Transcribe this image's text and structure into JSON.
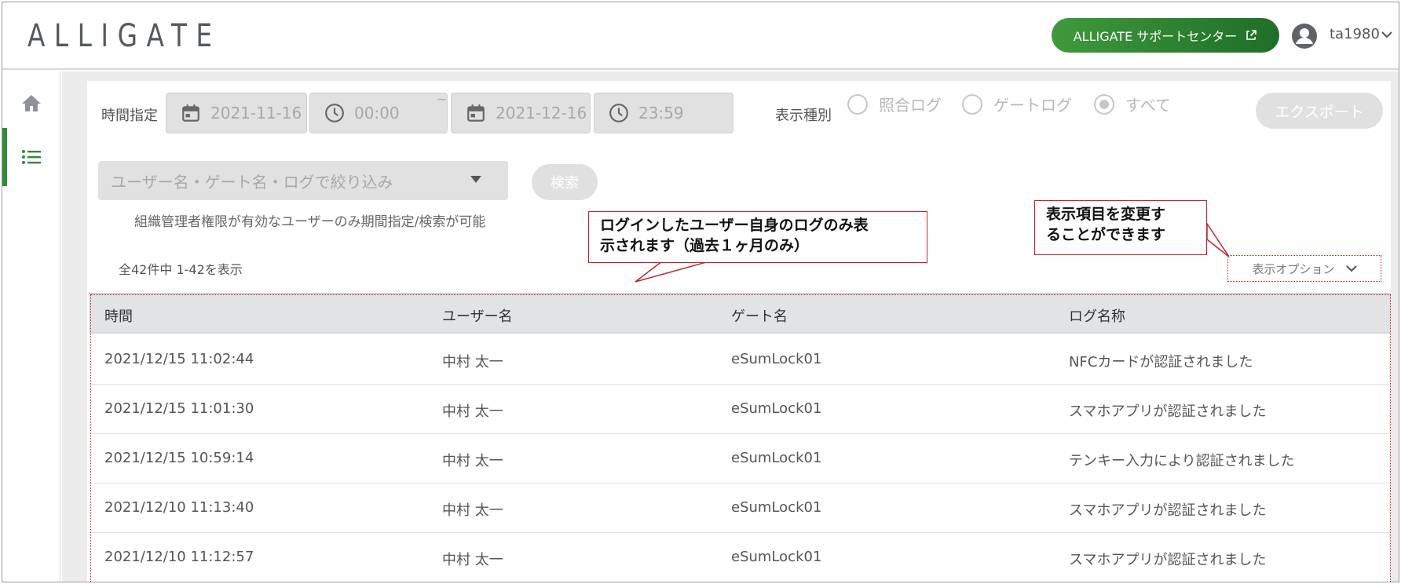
{
  "header": {
    "logo": "ALLIGATE",
    "support_button": "ALLIGATE サポートセンター",
    "username": "ta1980"
  },
  "sidebar": {
    "items": [
      {
        "icon": "home-icon"
      },
      {
        "icon": "list-icon",
        "active": true
      }
    ]
  },
  "filters": {
    "time_label": "時間指定",
    "start_date": "2021-11-16",
    "start_time": "00:00",
    "separator": "~",
    "end_date": "2021-12-16",
    "end_time": "23:59",
    "display_type_label": "表示種別",
    "radio_options": [
      {
        "label": "照合ログ",
        "selected": false
      },
      {
        "label": "ゲートログ",
        "selected": false
      },
      {
        "label": "すべて",
        "selected": true
      }
    ],
    "export_button": "エクスポート",
    "search_placeholder": "ユーザー名・ゲート名・ログで絞り込み",
    "search_button": "検索",
    "search_note": "組織管理者権限が有効なユーザーのみ期間指定/検索が可能",
    "result_count": "全42件中 1-42を表示",
    "display_option": "表示オプション"
  },
  "callouts": {
    "log_note_line1": "ログインしたユーザー自身のログのみ表",
    "log_note_line2": "示されます（過去１ヶ月のみ）",
    "option_note_line1": "表示項目を変更す",
    "option_note_line2": "ることができます"
  },
  "table": {
    "headers": [
      "時間",
      "ユーザー名",
      "ゲート名",
      "ログ名称"
    ],
    "rows": [
      [
        "2021/12/15 11:02:44",
        "中村 太一",
        "eSumLock01",
        "NFCカードが認証されました"
      ],
      [
        "2021/12/15 11:01:30",
        "中村 太一",
        "eSumLock01",
        "スマホアプリが認証されました"
      ],
      [
        "2021/12/15 10:59:14",
        "中村 太一",
        "eSumLock01",
        "テンキー入力により認証されました"
      ],
      [
        "2021/12/10 11:13:40",
        "中村 太一",
        "eSumLock01",
        "スマホアプリが認証されました"
      ],
      [
        "2021/12/10 11:12:57",
        "中村 太一",
        "eSumLock01",
        "スマホアプリが認証されました"
      ]
    ]
  },
  "colors": {
    "brand_green": "#2f8a3a",
    "annotation_red": "#c0262d"
  }
}
